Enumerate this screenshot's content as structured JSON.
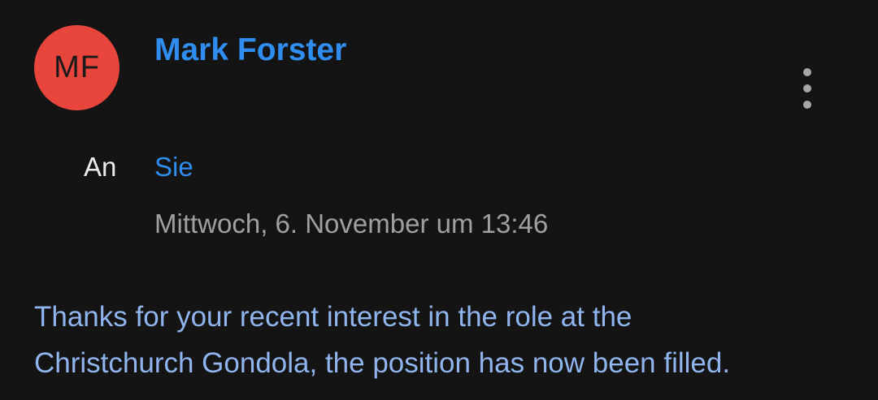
{
  "message": {
    "avatar_initials": "MF",
    "sender_name": "Mark Forster",
    "to_label": "An",
    "to_value": "Sie",
    "date": "Mittwoch, 6. November um 13:46",
    "body_lines": [
      "Thanks for your recent interest in the role at the",
      "Christchurch Gondola, the position has now been filled."
    ]
  },
  "colors": {
    "background": "#141414",
    "avatar": "#e8453c",
    "link_blue": "#2f8df0",
    "body_text": "#8fb4ee",
    "secondary_text": "#a0a0a0"
  },
  "icons": {
    "more": "more-vertical-icon"
  }
}
